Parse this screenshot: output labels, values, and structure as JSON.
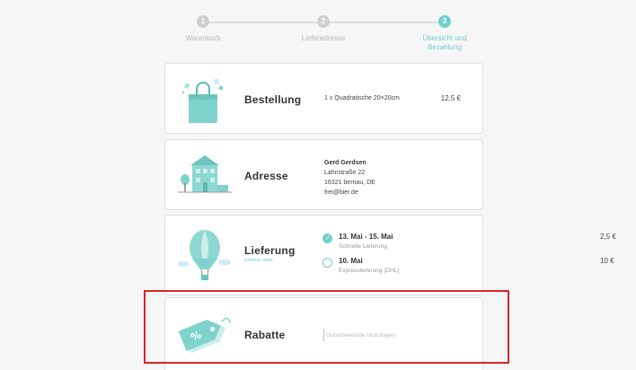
{
  "stepper": {
    "steps": [
      {
        "number": "1",
        "label": "Warenkorb"
      },
      {
        "number": "2",
        "label": "Lieferadresse"
      },
      {
        "number": "3",
        "label_line1": "Übersicht und",
        "label_line2": "Bezahlung"
      }
    ]
  },
  "order": {
    "title": "Bestellung",
    "item": "1 x Quadratische 20×20cm",
    "price": "12,5 €"
  },
  "address": {
    "title": "Adresse",
    "name": "Gerd Gerdsen",
    "street": "Lahnstraße 22",
    "city": "16321 bernau, DE",
    "email": "frei@bier.de"
  },
  "delivery": {
    "title": "Lieferung",
    "learn_more": "Erfahren mehr",
    "options": [
      {
        "title": "13. Mai - 15. Mai",
        "subtitle": "Schnelle Lieferung",
        "price": "2,5 €"
      },
      {
        "title": "10. Mai",
        "subtitle": "Expresslieferung (DHL)",
        "price": "10 €"
      }
    ]
  },
  "discount": {
    "title": "Rabatte",
    "placeholder": "Gutscheincode hinzufügen"
  },
  "colors": {
    "accent": "#6fd0c8",
    "highlight": "#d9262c"
  }
}
